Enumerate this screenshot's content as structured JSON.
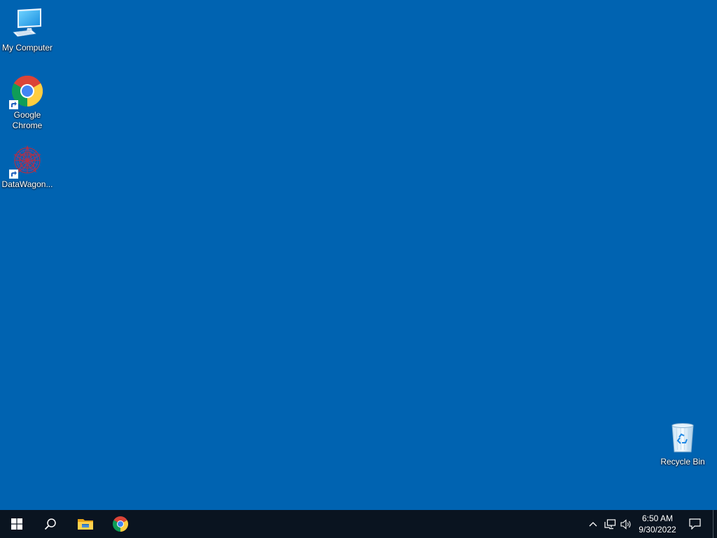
{
  "desktop": {
    "background_color": "#0063b1",
    "icons": [
      {
        "label": "My Computer",
        "icon": "computer-icon"
      },
      {
        "label": "Google Chrome",
        "icon": "chrome-icon",
        "shortcut": true
      },
      {
        "label": "DataWagon...",
        "icon": "datawagon-icon",
        "shortcut": true
      },
      {
        "label": "Recycle Bin",
        "icon": "recycle-bin-icon"
      }
    ]
  },
  "taskbar": {
    "background_color": "#0a1420",
    "start_icon": "windows-logo-icon",
    "search_icon": "search-icon",
    "pinned": [
      {
        "name": "File Explorer",
        "icon": "folder-icon"
      },
      {
        "name": "Google Chrome",
        "icon": "chrome-icon"
      }
    ],
    "tray": {
      "icons": [
        "chevron-up-icon",
        "network-icon",
        "volume-icon"
      ],
      "time": "6:50 AM",
      "date": "9/30/2022",
      "notification_icon": "action-center-icon"
    }
  }
}
